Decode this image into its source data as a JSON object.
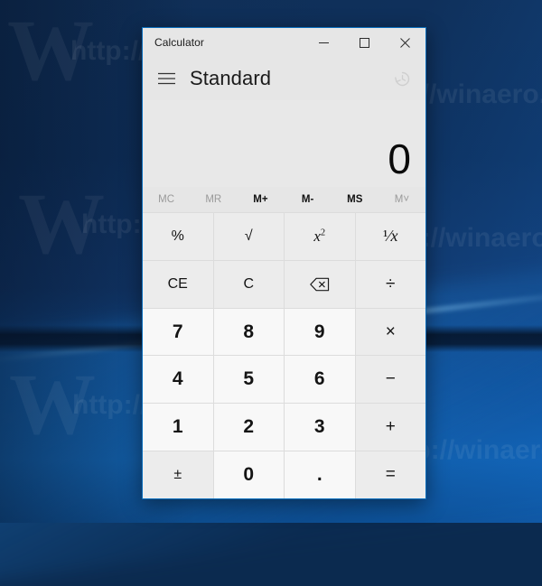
{
  "desktop": {
    "watermarks": [
      {
        "text": "W",
        "type": "big"
      },
      {
        "text": "http://winaero.com",
        "type": "url"
      },
      {
        "text": "winaero.com",
        "type": "url"
      }
    ]
  },
  "window": {
    "title": "Calculator",
    "caption_buttons": [
      {
        "name": "minimize",
        "label": "—"
      },
      {
        "name": "maximize",
        "label": "□"
      },
      {
        "name": "close",
        "label": "✕"
      }
    ],
    "accent_border_color": "#0a6ebd",
    "chrome_color": "#e6e6e6"
  },
  "header": {
    "menu_icon": "hamburger-icon",
    "mode_title": "Standard",
    "history_icon": "history-clock-icon"
  },
  "display": {
    "value": "0"
  },
  "memory": {
    "buttons": [
      {
        "label": "MC",
        "name": "memory-clear",
        "enabled": false
      },
      {
        "label": "MR",
        "name": "memory-recall",
        "enabled": false
      },
      {
        "label": "M+",
        "name": "memory-add",
        "enabled": true
      },
      {
        "label": "M-",
        "name": "memory-subtract",
        "enabled": true
      },
      {
        "label": "MS",
        "name": "memory-store",
        "enabled": true
      },
      {
        "label": "M˅",
        "name": "memory-dropdown",
        "enabled": false
      }
    ]
  },
  "keypad": {
    "rows": [
      [
        {
          "label": "%",
          "name": "percent-button",
          "kind": "func"
        },
        {
          "label": "√",
          "name": "square-root-button",
          "kind": "func"
        },
        {
          "label": "x²",
          "name": "square-button",
          "kind": "square"
        },
        {
          "label": "¹/x",
          "name": "reciprocal-button",
          "kind": "reciprocal"
        }
      ],
      [
        {
          "label": "CE",
          "name": "clear-entry-button",
          "kind": "func"
        },
        {
          "label": "C",
          "name": "clear-button",
          "kind": "func"
        },
        {
          "label": "⌫",
          "name": "backspace-button",
          "kind": "backspace"
        },
        {
          "label": "÷",
          "name": "divide-button",
          "kind": "op"
        }
      ],
      [
        {
          "label": "7",
          "name": "digit-7-button",
          "kind": "digit"
        },
        {
          "label": "8",
          "name": "digit-8-button",
          "kind": "digit"
        },
        {
          "label": "9",
          "name": "digit-9-button",
          "kind": "digit"
        },
        {
          "label": "×",
          "name": "multiply-button",
          "kind": "op"
        }
      ],
      [
        {
          "label": "4",
          "name": "digit-4-button",
          "kind": "digit"
        },
        {
          "label": "5",
          "name": "digit-5-button",
          "kind": "digit"
        },
        {
          "label": "6",
          "name": "digit-6-button",
          "kind": "digit"
        },
        {
          "label": "−",
          "name": "subtract-button",
          "kind": "op"
        }
      ],
      [
        {
          "label": "1",
          "name": "digit-1-button",
          "kind": "digit"
        },
        {
          "label": "2",
          "name": "digit-2-button",
          "kind": "digit"
        },
        {
          "label": "3",
          "name": "digit-3-button",
          "kind": "digit"
        },
        {
          "label": "+",
          "name": "add-button",
          "kind": "op"
        }
      ],
      [
        {
          "label": "±",
          "name": "plus-minus-button",
          "kind": "func"
        },
        {
          "label": "0",
          "name": "digit-0-button",
          "kind": "digit"
        },
        {
          "label": ".",
          "name": "decimal-point-button",
          "kind": "digit"
        },
        {
          "label": "=",
          "name": "equals-button",
          "kind": "op"
        }
      ]
    ]
  }
}
